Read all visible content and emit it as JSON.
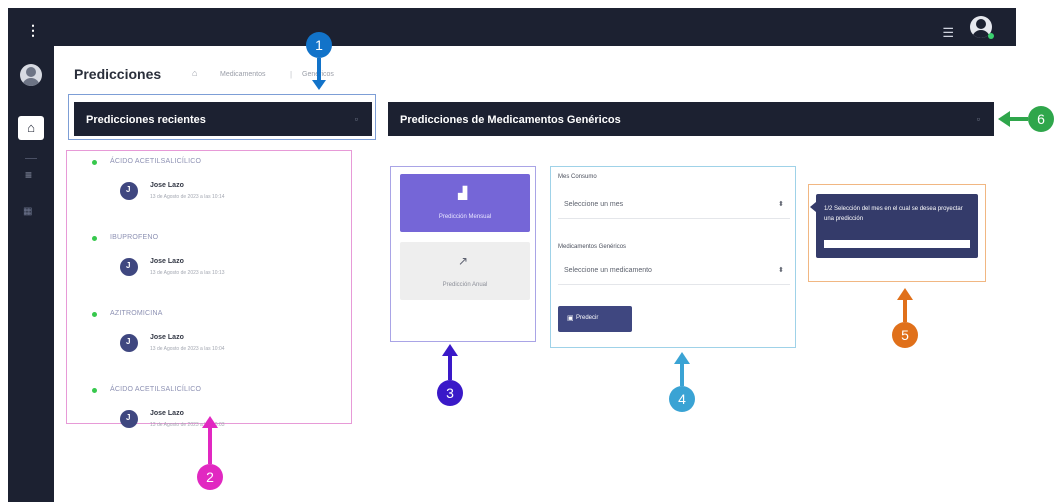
{
  "topbar": {
    "menu_icon": "list-icon",
    "user_icon": "user-avatar-icon"
  },
  "sidebar": {
    "menu_icon": "vertical-dots-icon",
    "items": [
      "home-icon",
      "list-icon",
      "chart-icon"
    ]
  },
  "page": {
    "title": "Predicciones"
  },
  "breadcrumb": {
    "home_icon": "home-icon",
    "items": [
      "Medicamentos",
      "Genéricos"
    ]
  },
  "recent_panel": {
    "title": "Predicciones recientes",
    "items": [
      {
        "drug": "ÁCIDO ACETILSALICÍLICO",
        "user": "Jose Lazo",
        "initial": "J",
        "date": "13 de Agosto de 2023 a las 10:14"
      },
      {
        "drug": "IBUPROFENO",
        "user": "Jose Lazo",
        "initial": "J",
        "date": "13 de Agosto de 2023 a las 10:13"
      },
      {
        "drug": "AZITROMICINA",
        "user": "Jose Lazo",
        "initial": "J",
        "date": "13 de Agosto de 2023 a las 10:04"
      },
      {
        "drug": "ÁCIDO ACETILSALICÍLICO",
        "user": "Jose Lazo",
        "initial": "J",
        "date": "13 de Agosto de 2023 a las 10:03"
      }
    ]
  },
  "generic_panel": {
    "title": "Predicciones de Medicamentos Genéricos",
    "types": {
      "monthly": "Predicción Mensual",
      "annual": "Predicción Anual"
    },
    "form": {
      "month_label": "Mes Consumo",
      "month_placeholder": "Seleccione un mes",
      "med_label": "Medicamentos Genéricos",
      "med_placeholder": "Seleccione un medicamento",
      "predict_label": "Predecir"
    },
    "tooltip": {
      "text": "1/2 Selección del mes en el cual se desea proyectar una predicción"
    }
  },
  "annotations": {
    "m1": "1",
    "m2": "2",
    "m3": "3",
    "m4": "4",
    "m5": "5",
    "m6": "6"
  },
  "colors": {
    "sidebar_bg": "#1c2131",
    "accent_purple": "#7566d7",
    "predict_btn": "#3f4780",
    "tooltip_bg": "#343b6a",
    "marker_1": "#1273c9",
    "marker_2": "#e128c1",
    "marker_3": "#3a19c8",
    "marker_4": "#3aa3d4",
    "marker_5": "#e0701a",
    "marker_6": "#2fa64b"
  }
}
